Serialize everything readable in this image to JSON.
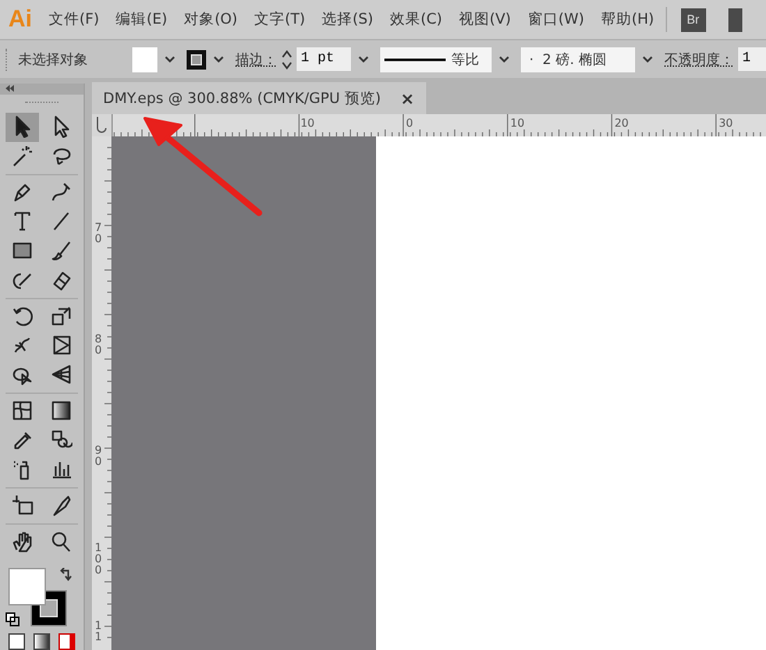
{
  "menu": {
    "logo": "Ai",
    "items": [
      "文件(F)",
      "编辑(E)",
      "对象(O)",
      "文字(T)",
      "选择(S)",
      "效果(C)",
      "视图(V)",
      "窗口(W)",
      "帮助(H)"
    ],
    "bridge": "Br"
  },
  "control_bar": {
    "selection": "未选择对象",
    "stroke_label": "描边：",
    "stroke_weight": "1 pt",
    "stroke_profile": "等比",
    "brush": "·  2 磅. 椭圆",
    "opacity_label": "不透明度：",
    "opacity_value": "1"
  },
  "tools": [
    {
      "selected": true
    },
    {
      "selected": false
    },
    {
      "selected": false
    },
    {
      "selected": false
    },
    {
      "selected": false
    },
    {
      "selected": false
    },
    {
      "selected": false
    },
    {
      "selected": false
    },
    {
      "selected": false
    },
    {
      "selected": false
    },
    {
      "selected": false
    },
    {
      "selected": false
    },
    {
      "selected": false
    },
    {
      "selected": false
    },
    {
      "selected": false
    },
    {
      "selected": false
    },
    {
      "selected": false
    },
    {
      "selected": false
    },
    {
      "selected": false
    },
    {
      "selected": false
    },
    {
      "selected": false
    },
    {
      "selected": false
    },
    {
      "selected": false
    },
    {
      "selected": false
    },
    {
      "selected": false
    },
    {
      "selected": false
    },
    {
      "selected": false
    },
    {
      "selected": false
    }
  ],
  "document_tab": {
    "title": "DMY.eps @ 300.88% (CMYK/GPU 预览)",
    "close": "×"
  },
  "rulers": {
    "horizontal": [
      "10",
      "0",
      "10",
      "20",
      "30"
    ],
    "vertical": [
      "70",
      "80",
      "90",
      "100",
      "11"
    ]
  }
}
